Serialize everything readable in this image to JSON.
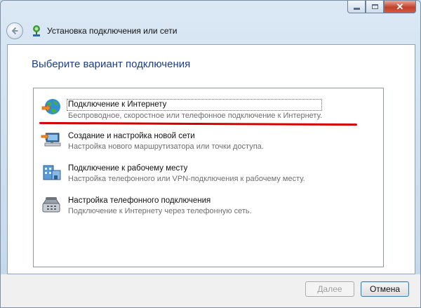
{
  "window": {
    "title": "Установка подключения или сети",
    "caption": {
      "minimize_icon": "minimize-icon",
      "maximize_icon": "maximize-icon",
      "close_glyph": "✕"
    },
    "back_icon": "back-arrow-icon"
  },
  "main": {
    "heading": "Выберите вариант подключения",
    "options": [
      {
        "title": "Подключение к Интернету",
        "desc": "Беспроводное, скоростное или телефонное подключение к Интернету.",
        "icon": "internet-globe-icon",
        "selected": true
      },
      {
        "title": "Создание и настройка новой сети",
        "desc": "Настройка нового маршрутизатора или точки доступа.",
        "icon": "new-network-icon"
      },
      {
        "title": "Подключение к рабочему месту",
        "desc": "Настройка телефонного или VPN-подключения к рабочему месту.",
        "icon": "workplace-icon"
      },
      {
        "title": "Настройка телефонного подключения",
        "desc": "Подключение к Интернету через телефонную сеть.",
        "icon": "dialup-phone-icon"
      }
    ]
  },
  "footer": {
    "next_label": "Далее",
    "cancel_label": "Отмена"
  },
  "colors": {
    "heading": "#1a3e8c",
    "annotation": "#d40000"
  }
}
